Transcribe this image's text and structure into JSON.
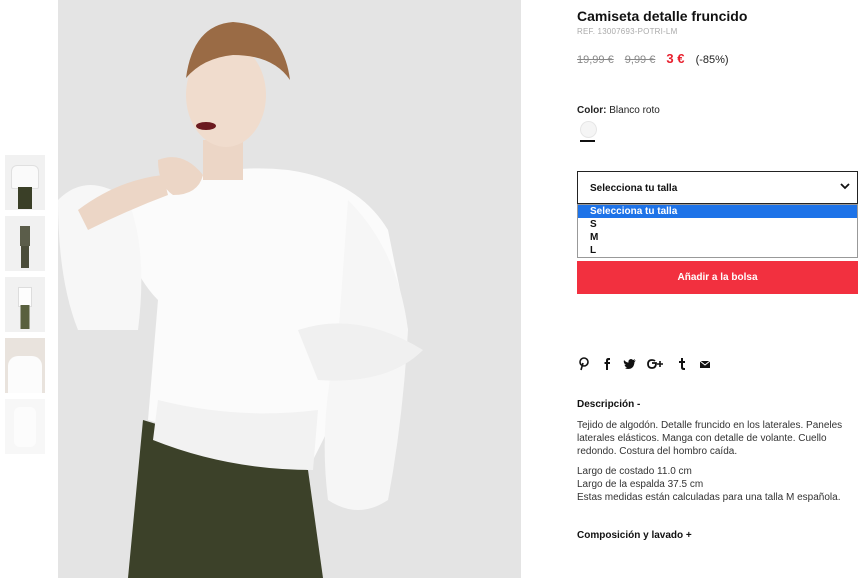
{
  "thumbnails": [
    {
      "name": "thumbnail-1"
    },
    {
      "name": "thumbnail-2"
    },
    {
      "name": "thumbnail-3"
    },
    {
      "name": "thumbnail-4"
    },
    {
      "name": "thumbnail-5"
    }
  ],
  "product": {
    "title": "Camiseta detalle fruncido",
    "ref": "REF. 13007693-POTRI-LM",
    "price_original": "19,99 €",
    "price_previous": "9,99 €",
    "price_current": "3 €",
    "discount": "(-85%)",
    "price_color": "#e8202e"
  },
  "color": {
    "label": "Color:",
    "value": "Blanco roto",
    "swatch_color": "#f5f5f5"
  },
  "size": {
    "select_label": "Selecciona tu talla",
    "options": [
      "Selecciona tu talla",
      "S",
      "M",
      "L"
    ],
    "selected_index": 0
  },
  "add_button_label": "Añadir a la bolsa",
  "add_button_color": "#f2303f",
  "share_icons": [
    "pinterest-icon",
    "facebook-icon",
    "twitter-icon",
    "google-plus-icon",
    "tumblr-icon",
    "email-icon"
  ],
  "description": {
    "heading": "Descripción -",
    "paragraph1": "Tejido de algodón. Detalle fruncido en los laterales. Paneles laterales elásticos. Manga con detalle de volante. Cuello redondo. Costura del hombro caída.",
    "line1": "Largo de costado 11.0 cm",
    "line2": "Largo de la espalda 37.5 cm",
    "line3": "Estas medidas están calculadas para una talla M española."
  },
  "composition_heading": "Composición y lavado +"
}
